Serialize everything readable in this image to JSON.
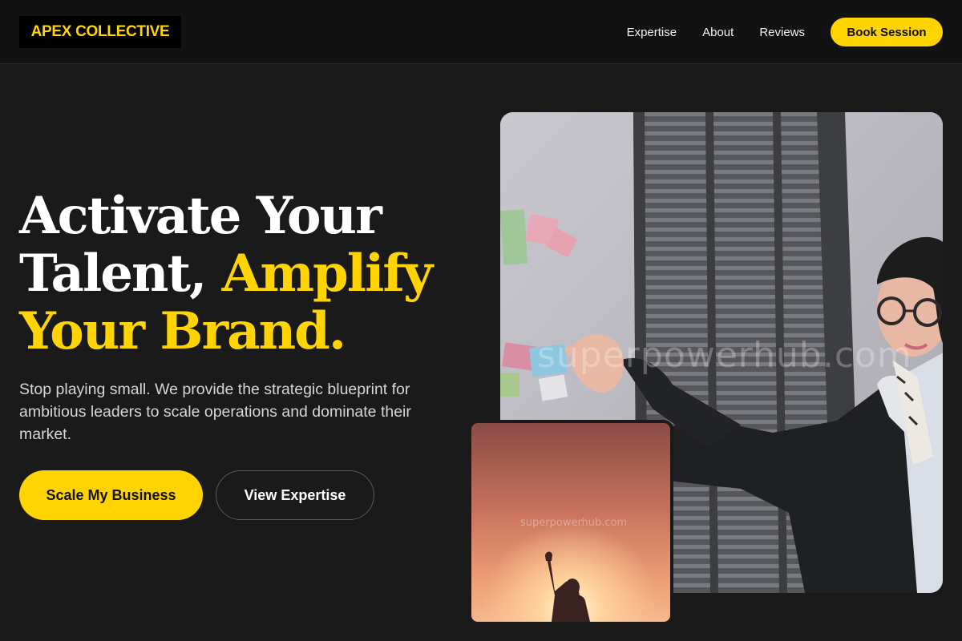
{
  "header": {
    "logo": "APEX COLLECTIVE",
    "nav": [
      "Expertise",
      "About",
      "Reviews"
    ],
    "book_label": "Book Session"
  },
  "hero": {
    "headline": {
      "line1": "Activate Your",
      "line2_white": "Talent, ",
      "line2_accent": "Amplify",
      "line3_accent": "Your Brand."
    },
    "subtext": "Stop playing small. We provide the strategic blueprint for ambitious leaders to scale operations and dominate their market.",
    "cta_primary": "Scale My Business",
    "cta_secondary": "View Expertise"
  },
  "images": {
    "watermark": "superpowerhub.com",
    "main_alt": "Woman in glasses pointing at sticky notes on a wall",
    "secondary_alt": "Silhouette raising a fist against a sunset"
  },
  "colors": {
    "accent": "#ffd400",
    "background": "#1a1a1a",
    "header_bg": "#121212"
  }
}
